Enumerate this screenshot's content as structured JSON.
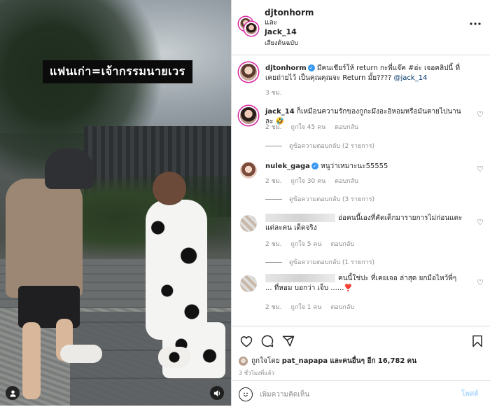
{
  "media": {
    "caption": "แฟนเก่า=เจ้ากรรมนายเวร"
  },
  "header": {
    "user1": "djtonhorm",
    "conjunction": "และ",
    "user2": "jack_14",
    "audio": "เสียงต้นฉบับ"
  },
  "post_caption": {
    "user": "djtonhorm",
    "text": "มีคนเชียร์ให้ return กะพี่แจ๊ค #อ่ะ เจอคลิปนี้ ที่เคยถ่ายไว้ เป็นคุณคุณจะ Return มั้ย???? ",
    "mention": "@jack_14",
    "time": "3 ชม."
  },
  "comments": [
    {
      "user": "jack_14",
      "text": "ก็เหมือนความรักของกูกะมึงอะอิหอมหรือมันตายไปนานละ 🤣",
      "time": "2 ชม.",
      "likes": "ถูกใจ 45 คน",
      "reply": "ตอบกลับ",
      "view_replies": "ดูข้อความตอบกลับ (2 รายการ)"
    },
    {
      "user": "nulek_gaga",
      "text": "หนูว่าเหมาะนะ55555",
      "time": "2 ชม.",
      "likes": "ถูกใจ 30 คน",
      "reply": "ตอบกลับ",
      "view_replies": "ดูข้อความตอบกลับ (3 รายการ)"
    },
    {
      "user": "",
      "text": "อ่อคนนี้เองที่คัดเด็กมารายการไม่ก่อนแตะ แต่ละคน เด็ดจริง",
      "time": "2 ชม.",
      "likes": "ถูกใจ 5 คน",
      "reply": "ตอบกลับ",
      "view_replies": "ดูข้อความตอบกลับ (1 รายการ)"
    },
    {
      "user": "",
      "text": "คนนี้ใช่ปะ ที่เคยเจอ ล่าสุด ยกมือไหว้พี่ๆ ... ที่หอม บอกว่า เจ็บ ......❣️",
      "time": "2 ชม.",
      "likes": "ถูกใจ 1 คน",
      "reply": "ตอบกลับ"
    }
  ],
  "likes_line": {
    "prefix": "ถูกใจโดย",
    "user": "pat_napapa",
    "and_others": "และคนอื่นๆ อีก",
    "count": "16,782",
    "suffix": "คน"
  },
  "time_ago": "3 ชั่วโมงที่แล้ว",
  "add_comment": {
    "placeholder": "เพิ่มความคิดเห็น",
    "post": "โพสต์"
  },
  "icons": {
    "more": "more-horizontal-icon",
    "heart": "heart-icon",
    "comment": "comment-icon",
    "share": "share-icon",
    "bookmark": "bookmark-icon",
    "emoji": "emoji-icon"
  },
  "colors": {
    "link": "#00376b",
    "verified": "#3897f0",
    "post_button_disabled": "#b3dbff",
    "muted": "#8e8e8e"
  }
}
